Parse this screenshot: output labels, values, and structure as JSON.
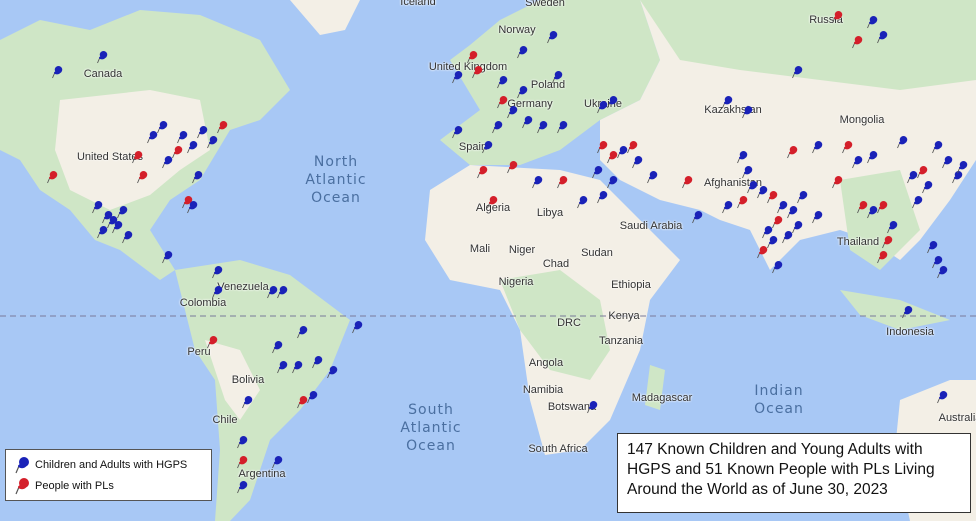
{
  "map": {
    "colors": {
      "ocean": "#a8c8f5",
      "land": "#f3efe6",
      "vegetation": "#cfe6c6",
      "hgps_pin": "#1a22b8",
      "pl_pin": "#d41f2a"
    },
    "country_labels": [
      "Canada",
      "United States",
      "Iceland",
      "Sweden",
      "Norway",
      "United Kingdom",
      "Poland",
      "Germany",
      "Ukraine",
      "Spain",
      "Kazakhstan",
      "Russia",
      "Mongolia",
      "Afghanistan",
      "Algeria",
      "Libya",
      "Mali",
      "Niger",
      "Chad",
      "Sudan",
      "Saudi Arabia",
      "Nigeria",
      "Ethiopia",
      "Kenya",
      "DRC",
      "Tanzania",
      "Angola",
      "Namibia",
      "Botswana",
      "South Africa",
      "Madagascar",
      "Venezuela",
      "Colombia",
      "Peru",
      "Bolivia",
      "Chile",
      "Argentina",
      "Thailand",
      "Indonesia",
      "Australia"
    ],
    "ocean_labels": [
      {
        "name": "north_atlantic",
        "text": "North\nAtlantic\nOcean"
      },
      {
        "name": "south_atlantic",
        "text": "South\nAtlantic\nOcean"
      },
      {
        "name": "indian",
        "text": "Indian\nOcean"
      }
    ]
  },
  "legend": {
    "items": [
      {
        "label": "Children and Adults with HGPS",
        "pin": "blue"
      },
      {
        "label": "People with PLs",
        "pin": "red"
      }
    ]
  },
  "info_box": {
    "text": "147 Known Children and Young Adults with HGPS and 51 Known People with PLs Living Around the World as of June 30, 2023"
  }
}
